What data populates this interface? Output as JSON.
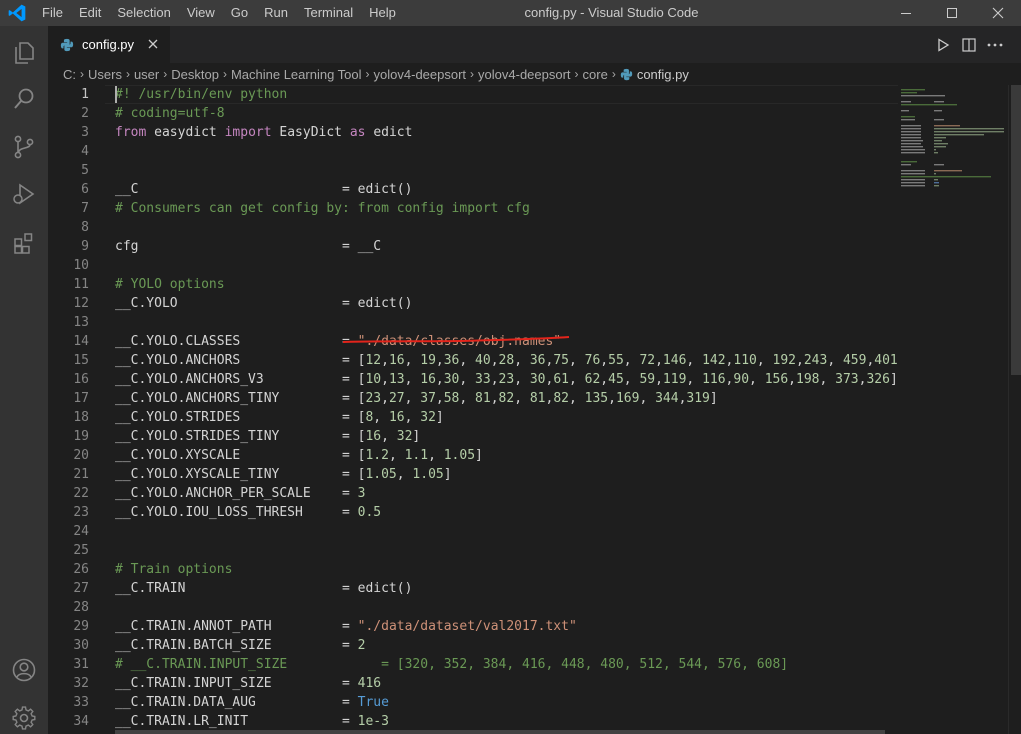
{
  "titlebar": {
    "menu": [
      "File",
      "Edit",
      "Selection",
      "View",
      "Go",
      "Run",
      "Terminal",
      "Help"
    ],
    "title": "config.py - Visual Studio Code"
  },
  "tab": {
    "label": "config.py"
  },
  "breadcrumb": [
    "C:",
    "Users",
    "user",
    "Desktop",
    "Machine Learning Tool",
    "yolov4-deepsort",
    "yolov4-deepsort",
    "core",
    "config.py"
  ],
  "editor": {
    "active_line": 1,
    "lines": [
      {
        "n": "1",
        "t": [
          [
            "comment",
            "#! /usr/bin/env python"
          ]
        ]
      },
      {
        "n": "2",
        "t": [
          [
            "comment",
            "# coding=utf-8"
          ]
        ]
      },
      {
        "n": "3",
        "t": [
          [
            "kw",
            "from"
          ],
          [
            "id",
            " easydict "
          ],
          [
            "kw",
            "import"
          ],
          [
            "id",
            " EasyDict "
          ],
          [
            "kw",
            "as"
          ],
          [
            "id",
            " edict"
          ]
        ]
      },
      {
        "n": "4",
        "t": []
      },
      {
        "n": "5",
        "t": []
      },
      {
        "n": "6",
        "t": [
          [
            "id",
            "__C                          = edict()"
          ]
        ]
      },
      {
        "n": "7",
        "t": [
          [
            "comment",
            "# Consumers can get config by: from config import cfg"
          ]
        ]
      },
      {
        "n": "8",
        "t": []
      },
      {
        "n": "9",
        "t": [
          [
            "id",
            "cfg                          = __C"
          ]
        ]
      },
      {
        "n": "10",
        "t": []
      },
      {
        "n": "11",
        "t": [
          [
            "comment",
            "# YOLO options"
          ]
        ]
      },
      {
        "n": "12",
        "t": [
          [
            "id",
            "__C.YOLO                     = edict()"
          ]
        ]
      },
      {
        "n": "13",
        "t": []
      },
      {
        "n": "14",
        "t": [
          [
            "id",
            "__C.YOLO.CLASSES             = "
          ],
          [
            "str",
            "\"./data/classes/obj.names\""
          ]
        ]
      },
      {
        "n": "15",
        "t": [
          [
            "id",
            "__C.YOLO.ANCHORS             = ["
          ],
          [
            "num",
            "12"
          ],
          [
            "id",
            ","
          ],
          [
            "num",
            "16"
          ],
          [
            "id",
            ", "
          ],
          [
            "num",
            "19"
          ],
          [
            "id",
            ","
          ],
          [
            "num",
            "36"
          ],
          [
            "id",
            ", "
          ],
          [
            "num",
            "40"
          ],
          [
            "id",
            ","
          ],
          [
            "num",
            "28"
          ],
          [
            "id",
            ", "
          ],
          [
            "num",
            "36"
          ],
          [
            "id",
            ","
          ],
          [
            "num",
            "75"
          ],
          [
            "id",
            ", "
          ],
          [
            "num",
            "76"
          ],
          [
            "id",
            ","
          ],
          [
            "num",
            "55"
          ],
          [
            "id",
            ", "
          ],
          [
            "num",
            "72"
          ],
          [
            "id",
            ","
          ],
          [
            "num",
            "146"
          ],
          [
            "id",
            ", "
          ],
          [
            "num",
            "142"
          ],
          [
            "id",
            ","
          ],
          [
            "num",
            "110"
          ],
          [
            "id",
            ", "
          ],
          [
            "num",
            "192"
          ],
          [
            "id",
            ","
          ],
          [
            "num",
            "243"
          ],
          [
            "id",
            ", "
          ],
          [
            "num",
            "459"
          ],
          [
            "id",
            ","
          ],
          [
            "num",
            "401"
          ],
          [
            "id",
            "]"
          ]
        ]
      },
      {
        "n": "16",
        "t": [
          [
            "id",
            "__C.YOLO.ANCHORS_V3          = ["
          ],
          [
            "num",
            "10"
          ],
          [
            "id",
            ","
          ],
          [
            "num",
            "13"
          ],
          [
            "id",
            ", "
          ],
          [
            "num",
            "16"
          ],
          [
            "id",
            ","
          ],
          [
            "num",
            "30"
          ],
          [
            "id",
            ", "
          ],
          [
            "num",
            "33"
          ],
          [
            "id",
            ","
          ],
          [
            "num",
            "23"
          ],
          [
            "id",
            ", "
          ],
          [
            "num",
            "30"
          ],
          [
            "id",
            ","
          ],
          [
            "num",
            "61"
          ],
          [
            "id",
            ", "
          ],
          [
            "num",
            "62"
          ],
          [
            "id",
            ","
          ],
          [
            "num",
            "45"
          ],
          [
            "id",
            ", "
          ],
          [
            "num",
            "59"
          ],
          [
            "id",
            ","
          ],
          [
            "num",
            "119"
          ],
          [
            "id",
            ", "
          ],
          [
            "num",
            "116"
          ],
          [
            "id",
            ","
          ],
          [
            "num",
            "90"
          ],
          [
            "id",
            ", "
          ],
          [
            "num",
            "156"
          ],
          [
            "id",
            ","
          ],
          [
            "num",
            "198"
          ],
          [
            "id",
            ", "
          ],
          [
            "num",
            "373"
          ],
          [
            "id",
            ","
          ],
          [
            "num",
            "326"
          ],
          [
            "id",
            "]"
          ]
        ]
      },
      {
        "n": "17",
        "t": [
          [
            "id",
            "__C.YOLO.ANCHORS_TINY        = ["
          ],
          [
            "num",
            "23"
          ],
          [
            "id",
            ","
          ],
          [
            "num",
            "27"
          ],
          [
            "id",
            ", "
          ],
          [
            "num",
            "37"
          ],
          [
            "id",
            ","
          ],
          [
            "num",
            "58"
          ],
          [
            "id",
            ", "
          ],
          [
            "num",
            "81"
          ],
          [
            "id",
            ","
          ],
          [
            "num",
            "82"
          ],
          [
            "id",
            ", "
          ],
          [
            "num",
            "81"
          ],
          [
            "id",
            ","
          ],
          [
            "num",
            "82"
          ],
          [
            "id",
            ", "
          ],
          [
            "num",
            "135"
          ],
          [
            "id",
            ","
          ],
          [
            "num",
            "169"
          ],
          [
            "id",
            ", "
          ],
          [
            "num",
            "344"
          ],
          [
            "id",
            ","
          ],
          [
            "num",
            "319"
          ],
          [
            "id",
            "]"
          ]
        ]
      },
      {
        "n": "18",
        "t": [
          [
            "id",
            "__C.YOLO.STRIDES             = ["
          ],
          [
            "num",
            "8"
          ],
          [
            "id",
            ", "
          ],
          [
            "num",
            "16"
          ],
          [
            "id",
            ", "
          ],
          [
            "num",
            "32"
          ],
          [
            "id",
            "]"
          ]
        ]
      },
      {
        "n": "19",
        "t": [
          [
            "id",
            "__C.YOLO.STRIDES_TINY        = ["
          ],
          [
            "num",
            "16"
          ],
          [
            "id",
            ", "
          ],
          [
            "num",
            "32"
          ],
          [
            "id",
            "]"
          ]
        ]
      },
      {
        "n": "20",
        "t": [
          [
            "id",
            "__C.YOLO.XYSCALE             = ["
          ],
          [
            "num",
            "1.2"
          ],
          [
            "id",
            ", "
          ],
          [
            "num",
            "1.1"
          ],
          [
            "id",
            ", "
          ],
          [
            "num",
            "1.05"
          ],
          [
            "id",
            "]"
          ]
        ]
      },
      {
        "n": "21",
        "t": [
          [
            "id",
            "__C.YOLO.XYSCALE_TINY        = ["
          ],
          [
            "num",
            "1.05"
          ],
          [
            "id",
            ", "
          ],
          [
            "num",
            "1.05"
          ],
          [
            "id",
            "]"
          ]
        ]
      },
      {
        "n": "22",
        "t": [
          [
            "id",
            "__C.YOLO.ANCHOR_PER_SCALE    = "
          ],
          [
            "num",
            "3"
          ]
        ]
      },
      {
        "n": "23",
        "t": [
          [
            "id",
            "__C.YOLO.IOU_LOSS_THRESH     = "
          ],
          [
            "num",
            "0.5"
          ]
        ]
      },
      {
        "n": "24",
        "t": []
      },
      {
        "n": "25",
        "t": []
      },
      {
        "n": "26",
        "t": [
          [
            "comment",
            "# Train options"
          ]
        ]
      },
      {
        "n": "27",
        "t": [
          [
            "id",
            "__C.TRAIN                    = edict()"
          ]
        ]
      },
      {
        "n": "28",
        "t": []
      },
      {
        "n": "29",
        "t": [
          [
            "id",
            "__C.TRAIN.ANNOT_PATH         = "
          ],
          [
            "str",
            "\"./data/dataset/val2017.txt\""
          ]
        ]
      },
      {
        "n": "30",
        "t": [
          [
            "id",
            "__C.TRAIN.BATCH_SIZE         = "
          ],
          [
            "num",
            "2"
          ]
        ]
      },
      {
        "n": "31",
        "t": [
          [
            "comment",
            "# __C.TRAIN.INPUT_SIZE            = [320, 352, 384, 416, 448, 480, 512, 544, 576, 608]"
          ]
        ]
      },
      {
        "n": "32",
        "t": [
          [
            "id",
            "__C.TRAIN.INPUT_SIZE         = "
          ],
          [
            "num",
            "416"
          ]
        ]
      },
      {
        "n": "33",
        "t": [
          [
            "id",
            "__C.TRAIN.DATA_AUG           = "
          ],
          [
            "const",
            "True"
          ]
        ]
      },
      {
        "n": "34",
        "t": [
          [
            "id",
            "__C.TRAIN.LR_INIT            = "
          ],
          [
            "num",
            "1e-3"
          ]
        ]
      }
    ]
  }
}
